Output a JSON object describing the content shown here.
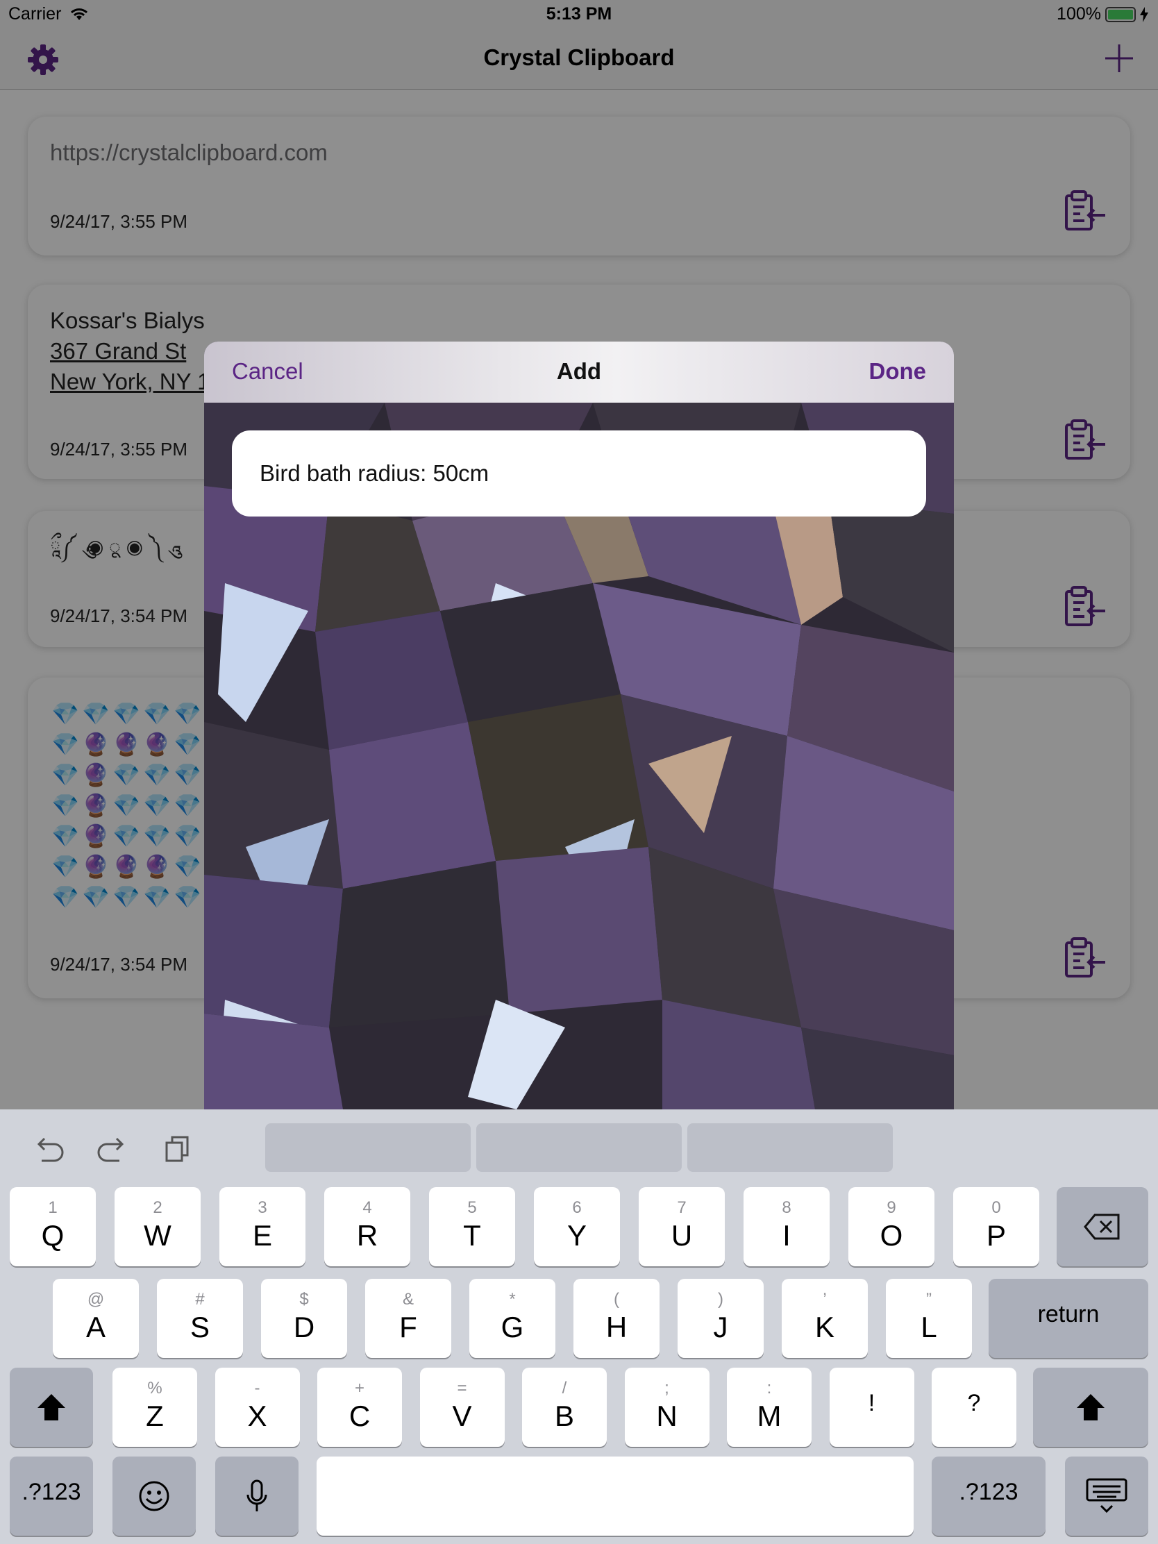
{
  "status_bar": {
    "carrier": "Carrier",
    "time": "5:13 PM",
    "battery": "100%"
  },
  "nav": {
    "title": "Crystal Clipboard",
    "settings_icon": "gear-icon",
    "add_icon": "plus-icon"
  },
  "clips": [
    {
      "text": "https://crystalclipboard.com",
      "date": "9/24/17, 3:55 PM"
    },
    {
      "lines": [
        "Kossar's Bialys",
        "367 Grand St",
        "New York, NY 1"
      ],
      "date": "9/24/17, 3:55 PM"
    },
    {
      "text": "ཱྀ༼ ཱུ ◉ ू ◉ ༽ ཱུ",
      "date": "9/24/17, 3:54 PM"
    },
    {
      "emoji_rows": [
        [
          "💎",
          "💎",
          "💎",
          "💎",
          "💎"
        ],
        [
          "💎",
          "🔮",
          "🔮",
          "🔮",
          "💎"
        ],
        [
          "💎",
          "🔮",
          "💎",
          "💎",
          "💎"
        ],
        [
          "💎",
          "🔮",
          "💎",
          "💎",
          "💎"
        ],
        [
          "💎",
          "🔮",
          "💎",
          "💎",
          "💎"
        ],
        [
          "💎",
          "🔮",
          "🔮",
          "🔮",
          "💎"
        ],
        [
          "💎",
          "💎",
          "💎",
          "💎",
          "💎"
        ]
      ],
      "date": "9/24/17, 3:54 PM"
    }
  ],
  "modal": {
    "title": "Add",
    "cancel": "Cancel",
    "done": "Done",
    "input_value": "Bird bath radius: 50cm"
  },
  "keyboard": {
    "row1": [
      {
        "t": "1",
        "m": "Q"
      },
      {
        "t": "2",
        "m": "W"
      },
      {
        "t": "3",
        "m": "E"
      },
      {
        "t": "4",
        "m": "R"
      },
      {
        "t": "5",
        "m": "T"
      },
      {
        "t": "6",
        "m": "Y"
      },
      {
        "t": "7",
        "m": "U"
      },
      {
        "t": "8",
        "m": "I"
      },
      {
        "t": "9",
        "m": "O"
      },
      {
        "t": "0",
        "m": "P"
      }
    ],
    "row2": [
      {
        "t": "@",
        "m": "A"
      },
      {
        "t": "#",
        "m": "S"
      },
      {
        "t": "$",
        "m": "D"
      },
      {
        "t": "&",
        "m": "F"
      },
      {
        "t": "*",
        "m": "G"
      },
      {
        "t": "(",
        "m": "H"
      },
      {
        "t": ")",
        "m": "J"
      },
      {
        "t": "’",
        "m": "K"
      },
      {
        "t": "”",
        "m": "L"
      }
    ],
    "row3": [
      {
        "t": "%",
        "m": "Z"
      },
      {
        "t": "-",
        "m": "X"
      },
      {
        "t": "+",
        "m": "C"
      },
      {
        "t": "=",
        "m": "V"
      },
      {
        "t": "/",
        "m": "B"
      },
      {
        "t": ";",
        "m": "N"
      },
      {
        "t": ":",
        "m": "M"
      },
      {
        "t": "",
        "m": "!"
      },
      {
        "t": "",
        "m": "?"
      }
    ],
    "return": "return",
    "numbers": ".?123",
    "colors": {
      "accent": "#5b2585"
    }
  }
}
